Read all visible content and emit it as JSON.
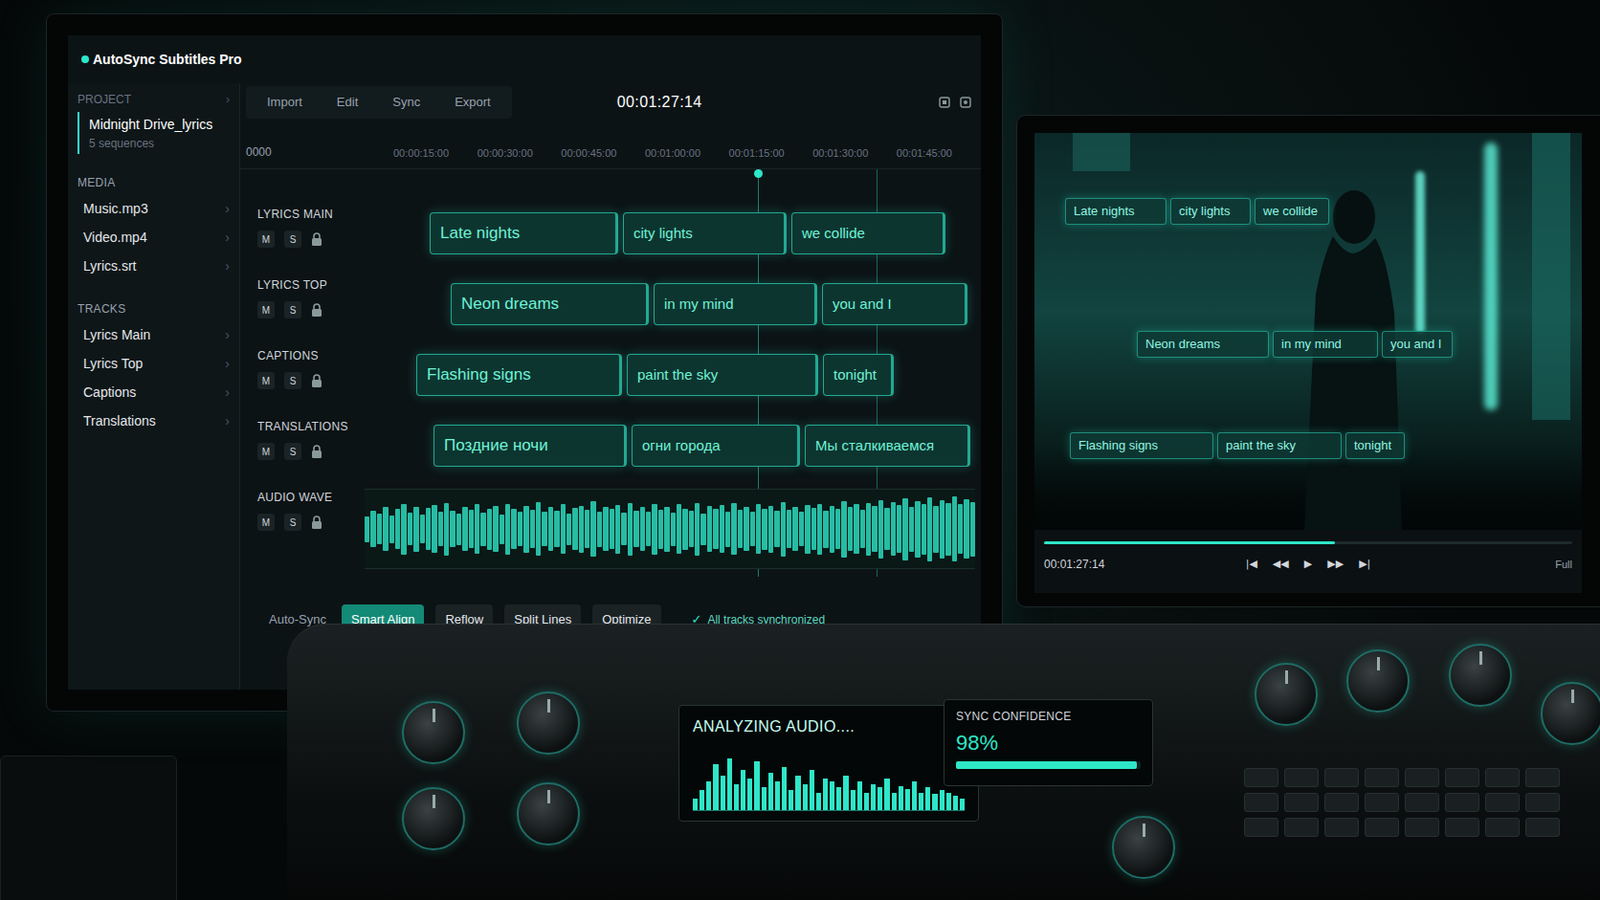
{
  "app": {
    "title": "AutoSync Subtitles Pro"
  },
  "sidebar": {
    "chevron": "›",
    "project": {
      "heading": "PROJECT",
      "name": "Midnight Drive_lyrics",
      "meta": "5 sequences",
      "selected": true
    },
    "sections": [
      {
        "heading": "MEDIA",
        "items": [
          {
            "label": "Music.mp3"
          },
          {
            "label": "Video.mp4"
          },
          {
            "label": "Lyrics.srt"
          }
        ]
      },
      {
        "heading": "TRACKS",
        "items": [
          {
            "label": "Lyrics Main"
          },
          {
            "label": "Lyrics Top"
          },
          {
            "label": "Captions"
          },
          {
            "label": "Translations"
          }
        ]
      }
    ]
  },
  "menu": [
    {
      "label": "Import",
      "selected": false
    },
    {
      "label": "Edit",
      "selected": false
    },
    {
      "label": "Sync",
      "selected": false
    },
    {
      "label": "Export",
      "selected": false
    }
  ],
  "timecode": "00:01:27:14",
  "ruler": {
    "start": "0000",
    "ticks": [
      "00:00:15:00",
      "00:00:30:00",
      "00:00:45:00",
      "00:01:00:00",
      "00:01:15:00",
      "00:01:30:00",
      "00:01:45:00"
    ]
  },
  "tracks": [
    {
      "name": "LYRICS MAIN",
      "mute": "M",
      "solo": "S",
      "locked": true,
      "clips": [
        "Late nights",
        "city lights",
        "we collide"
      ]
    },
    {
      "name": "LYRICS TOP",
      "mute": "M",
      "solo": "S",
      "locked": true,
      "clips": [
        "Neon dreams",
        "in my mind",
        "you and I"
      ]
    },
    {
      "name": "CAPTIONS",
      "mute": "M",
      "solo": "S",
      "locked": true,
      "clips": [
        "Flashing signs",
        "paint the sky",
        "tonight"
      ]
    },
    {
      "name": "TRANSLATIONS",
      "mute": "M",
      "solo": "S",
      "locked": true,
      "clips": [
        "Поздние ночи",
        "огни города",
        "Мы сталкиваемся"
      ]
    }
  ],
  "audio": {
    "name": "AUDIO WAVE",
    "mute": "M",
    "solo": "S",
    "locked": true,
    "wave": [
      0.35,
      0.5,
      0.42,
      0.6,
      0.38,
      0.55,
      0.7,
      0.45,
      0.62,
      0.4,
      0.58,
      0.66,
      0.48,
      0.72,
      0.5,
      0.44,
      0.6,
      0.52,
      0.68,
      0.46,
      0.57,
      0.63,
      0.41,
      0.7,
      0.55,
      0.48,
      0.65,
      0.53,
      0.74,
      0.47,
      0.6,
      0.5,
      0.69,
      0.43,
      0.58,
      0.64,
      0.52,
      0.76,
      0.49,
      0.61,
      0.55,
      0.67,
      0.45,
      0.72,
      0.5,
      0.6,
      0.48,
      0.7,
      0.54,
      0.62,
      0.46,
      0.68,
      0.57,
      0.5,
      0.73,
      0.44,
      0.63,
      0.55,
      0.66,
      0.49,
      0.71,
      0.52,
      0.6,
      0.47,
      0.69,
      0.56,
      0.64,
      0.5,
      0.75,
      0.53,
      0.61,
      0.48,
      0.67,
      0.58,
      0.7,
      0.51,
      0.65,
      0.55,
      0.78,
      0.6,
      0.68,
      0.52,
      0.72,
      0.63,
      0.8,
      0.58,
      0.74,
      0.66,
      0.85,
      0.62,
      0.77,
      0.7,
      0.88,
      0.65,
      0.8,
      0.72,
      0.9,
      0.68,
      0.82,
      0.75
    ]
  },
  "toolbar": {
    "label": "Auto-Sync",
    "buttons": [
      {
        "label": "Smart Align",
        "selected": true
      },
      {
        "label": "Reflow",
        "selected": false
      },
      {
        "label": "Split Lines",
        "selected": false
      },
      {
        "label": "Optimize",
        "selected": false
      }
    ],
    "status_icon": "✓",
    "status": "All tracks synchronized"
  },
  "preview": {
    "subtitles": [
      [
        "Late nights",
        "city lights",
        "we collide"
      ],
      [
        "Neon dreams",
        "in my mind",
        "you and I"
      ],
      [
        "Flashing signs",
        "paint the sky",
        "tonight"
      ]
    ],
    "progress": {
      "level": 0.55
    },
    "timecode": "00:01:27:14",
    "controls": [
      "|◀",
      "◀◀",
      "▶",
      "▶▶",
      "▶|"
    ],
    "size": "Full"
  },
  "console": {
    "display": {
      "text": "ANALYZING AUDIO....",
      "wave": [
        0.2,
        0.35,
        0.5,
        0.8,
        0.6,
        0.9,
        0.45,
        0.7,
        0.55,
        0.85,
        0.4,
        0.65,
        0.5,
        0.75,
        0.35,
        0.6,
        0.45,
        0.7,
        0.3,
        0.55,
        0.5,
        0.4,
        0.6,
        0.35,
        0.5,
        0.3,
        0.45,
        0.4,
        0.55,
        0.3,
        0.42,
        0.36,
        0.5,
        0.3,
        0.4,
        0.28,
        0.35,
        0.3,
        0.25,
        0.2
      ]
    },
    "confidence": {
      "label": "SYNC CONFIDENCE",
      "reading": "98%",
      "level": 0.98
    }
  }
}
